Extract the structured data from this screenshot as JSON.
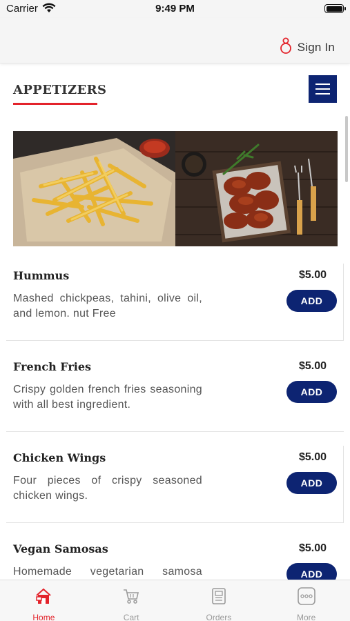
{
  "status_bar": {
    "carrier": "Carrier",
    "time": "9:49 PM"
  },
  "header": {
    "sign_in_label": "Sign In"
  },
  "section": {
    "title": "APPETIZERS"
  },
  "items": [
    {
      "name": "Hummus",
      "description": "Mashed chickpeas, tahini, olive oil, and lemon. nut Free",
      "price": "$5.00",
      "button_label": "ADD"
    },
    {
      "name": "French Fries",
      "description": "Crispy golden french fries seasoning with all best ingredient.",
      "price": "$5.00",
      "button_label": "ADD"
    },
    {
      "name": "Chicken Wings",
      "description": "Four pieces of crispy seasoned chicken wings.",
      "price": "$5.00",
      "button_label": "ADD"
    },
    {
      "name": "Vegan Samosas",
      "description": "Homemade vegetarian samosa",
      "price": "$5.00",
      "button_label": "ADD"
    }
  ],
  "tabs": [
    {
      "label": "Home",
      "icon": "home-icon",
      "active": true
    },
    {
      "label": "Cart",
      "icon": "cart-icon",
      "active": false
    },
    {
      "label": "Orders",
      "icon": "orders-icon",
      "active": false
    },
    {
      "label": "More",
      "icon": "more-icon",
      "active": false
    }
  ],
  "colors": {
    "brand_navy": "#0d2472",
    "accent_red": "#e3232b",
    "header_bg": "#f5f5f5"
  }
}
